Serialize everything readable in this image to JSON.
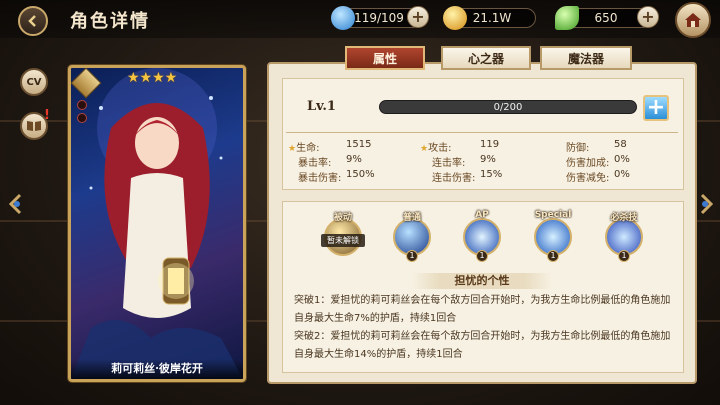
{
  "page_title": "角色详情",
  "resources": [
    {
      "name": "energy",
      "value": "119/109",
      "icon": "drop-icon",
      "color": "#4aa6e8"
    },
    {
      "name": "gold",
      "value": "21.1W",
      "icon": "coin-icon",
      "color": "#f0b72a"
    },
    {
      "name": "gem",
      "value": "650",
      "icon": "leaf-gem-icon",
      "color": "#7ed44a"
    }
  ],
  "side_buttons": {
    "cv": "CV",
    "story": "story-book-icon"
  },
  "card": {
    "name": "莉可莉丝·彼岸花开",
    "stars": "★★★★",
    "star_count": 4
  },
  "tabs": [
    {
      "label": "属性",
      "active": true
    },
    {
      "label": "心之器",
      "active": false
    },
    {
      "label": "魔法器",
      "active": false
    }
  ],
  "level": {
    "label": "Lv.1",
    "xp_text": "0/200",
    "xp_fraction": 0.0
  },
  "stats": {
    "hp": {
      "label": "生命:",
      "value": "1515"
    },
    "atk": {
      "label": "攻击:",
      "value": "119"
    },
    "def": {
      "label": "防御:",
      "value": "58"
    },
    "crit_rate": {
      "label": "暴击率:",
      "value": "9%"
    },
    "combo_rate": {
      "label": "连击率:",
      "value": "9%"
    },
    "dmg_bonus": {
      "label": "伤害加成:",
      "value": "0%"
    },
    "crit_dmg": {
      "label": "暴击伤害:",
      "value": "150%"
    },
    "combo_dmg": {
      "label": "连击伤害:",
      "value": "15%"
    },
    "dmg_reduce": {
      "label": "伤害减免:",
      "value": "0%"
    }
  },
  "skills": [
    {
      "label": "被动",
      "level": "",
      "locked_text": "暂未解锁"
    },
    {
      "label": "普通",
      "level": "1"
    },
    {
      "label": "AP",
      "level": "1"
    },
    {
      "label": "Special",
      "level": "1"
    },
    {
      "label": "必杀技",
      "level": "1"
    }
  ],
  "trait_title": "担忧的个性",
  "trait_desc": [
    "突破1：爱担忧的莉可莉丝会在每个敌方回合开始时，为我方生命比例最低的角色施加",
    "自身最大生命7%的护盾，持续1回合",
    "突破2：爱担忧的莉可莉丝会在每个敌方回合开始时，为我方生命比例最低的角色施加",
    "自身最大生命14%的护盾，持续1回合"
  ]
}
